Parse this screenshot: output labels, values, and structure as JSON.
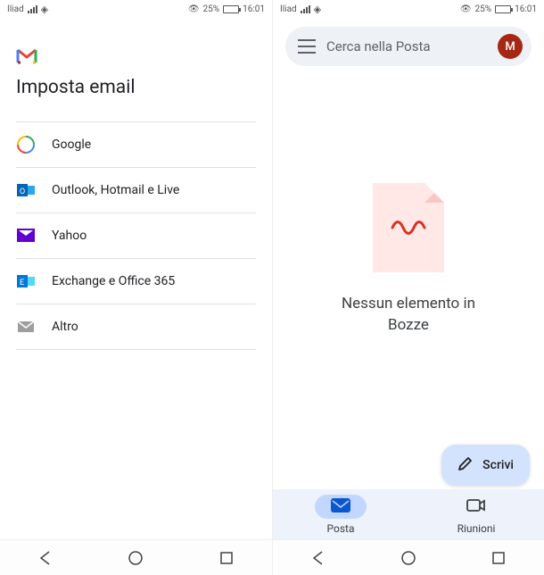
{
  "status": {
    "carrier": "Iliad",
    "battery_pct": "25%",
    "time": "16:01"
  },
  "left": {
    "title": "Imposta email",
    "providers": [
      {
        "label": "Google"
      },
      {
        "label": "Outlook, Hotmail e Live"
      },
      {
        "label": "Yahoo"
      },
      {
        "label": "Exchange e Office 365"
      },
      {
        "label": "Altro"
      }
    ]
  },
  "right": {
    "search_placeholder": "Cerca nella Posta",
    "avatar_initial": "M",
    "empty_line1": "Nessun elemento in",
    "empty_line2": "Bozze",
    "fab_label": "Scrivi",
    "tabs": {
      "mail": "Posta",
      "meet": "Riunioni"
    }
  }
}
